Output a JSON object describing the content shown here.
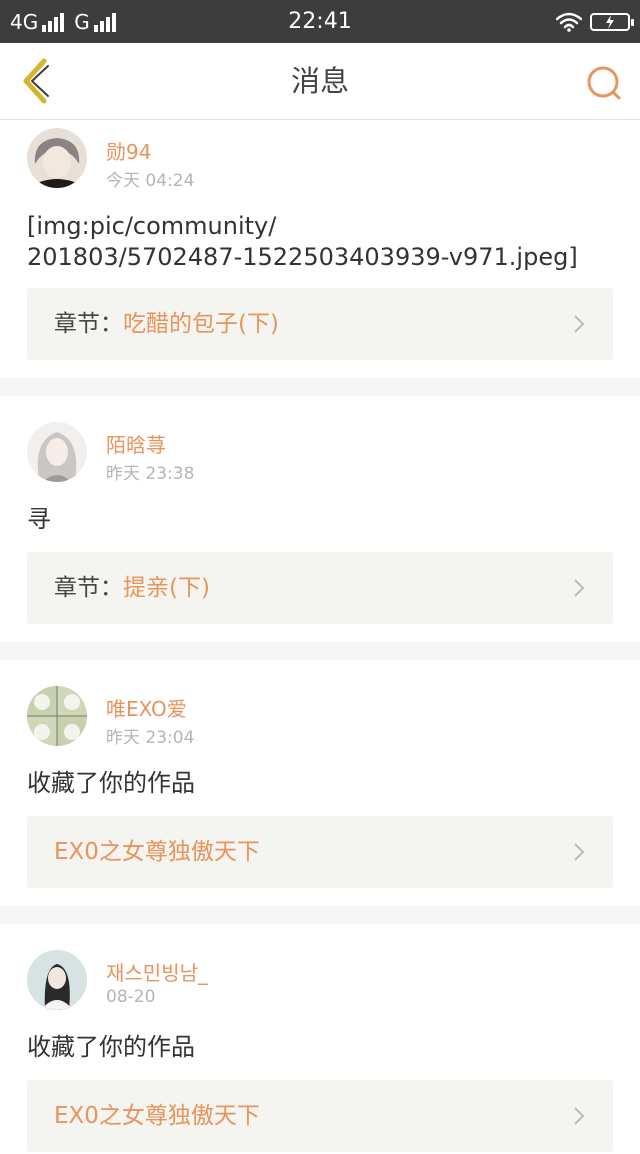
{
  "status_bar": {
    "network1": "4G",
    "network2": "G",
    "time": "22:41",
    "icons": [
      "signal-icon",
      "wifi-icon",
      "battery-charging-icon"
    ]
  },
  "nav": {
    "title": "消息",
    "back_icon": "chevron-left-icon",
    "search_icon": "search-icon",
    "accent_color": "#e8945c"
  },
  "messages": [
    {
      "user": "勋94",
      "time": "今天 04:24",
      "content": "[img:pic/community/\n201803/5702487-1522503403939-v971.jpeg]",
      "chapter_prefix": "章节：",
      "chapter_title": "吃醋的包子(下)"
    },
    {
      "user": "陌晗荨",
      "time": "昨天 23:38",
      "content": "寻",
      "chapter_prefix": "章节：",
      "chapter_title": "提亲(下)"
    },
    {
      "user": "唯EXO爱",
      "time": "昨天 23:04",
      "content": "收藏了你的作品",
      "chapter_prefix": "",
      "chapter_title": "EX0之女尊独傲天下"
    },
    {
      "user": "재스민빙남_",
      "time": "08-20",
      "content": "收藏了你的作品",
      "chapter_prefix": "",
      "chapter_title": "EX0之女尊独傲天下"
    }
  ]
}
